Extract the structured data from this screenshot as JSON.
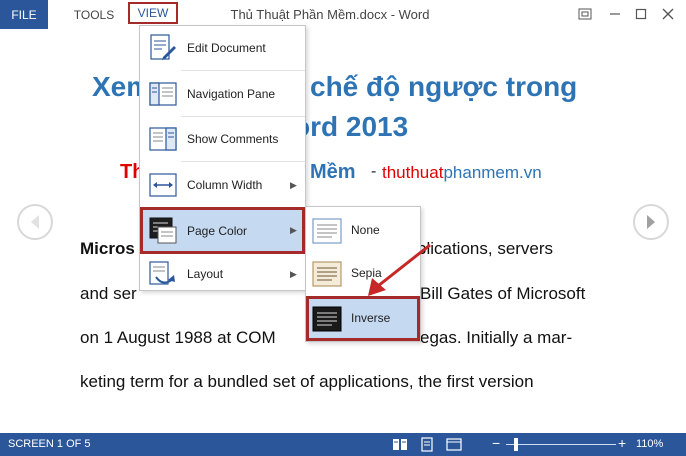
{
  "titlebar": {
    "file_label": "FILE",
    "tools_label": "TOOLS",
    "view_label": "VIEW",
    "document_title": "Thủ Thuật Phần Mềm.docx - Word"
  },
  "document": {
    "heading_part1": "Xem",
    "heading_part2": "chế độ ngược trong",
    "heading_line2": "ord 2013",
    "subtitle_left": "Th",
    "subtitle_mid": "Mềm",
    "subtitle_dash": "-",
    "site_red": "thuthuat",
    "site_blue": "phanmem.vn",
    "line1_left": "Micros",
    "line1_right": "plications, servers",
    "line2_left": "and ser",
    "line2_right": "Bill Gates of Microsoft",
    "line3_left": "on 1 August 1988 at COM",
    "line3_right": "egas. Initially a mar-",
    "line4": "keting term for a bundled set of applications, the first version"
  },
  "view_menu": {
    "items": [
      {
        "label": "Edit Document",
        "icon": "edit-document-icon",
        "submenu": false
      },
      {
        "label": "Navigation Pane",
        "icon": "navigation-pane-icon",
        "submenu": false
      },
      {
        "label": "Show Comments",
        "icon": "show-comments-icon",
        "submenu": false
      },
      {
        "label": "Column Width",
        "icon": "column-width-icon",
        "submenu": true
      },
      {
        "label": "Page Color",
        "icon": "page-color-icon",
        "submenu": true,
        "highlighted": true
      },
      {
        "label": "Layout",
        "icon": "layout-icon",
        "submenu": true
      }
    ]
  },
  "page_color_menu": {
    "items": [
      {
        "label": "None",
        "icon": "page-color-none-icon"
      },
      {
        "label": "Sepia",
        "icon": "page-color-sepia-icon"
      },
      {
        "label": "Inverse",
        "icon": "page-color-inverse-icon",
        "highlighted": true
      }
    ]
  },
  "statusbar": {
    "screen_text": "SCREEN 1 OF 5",
    "zoom_text": "110%",
    "zoom_minus": "−",
    "zoom_plus": "+"
  },
  "colors": {
    "accent": "#2b579a",
    "heading_blue": "#2e74b5",
    "brand_red": "#e00000",
    "highlight_border": "#a52a2a",
    "menu_highlight": "#c5d9f1"
  }
}
